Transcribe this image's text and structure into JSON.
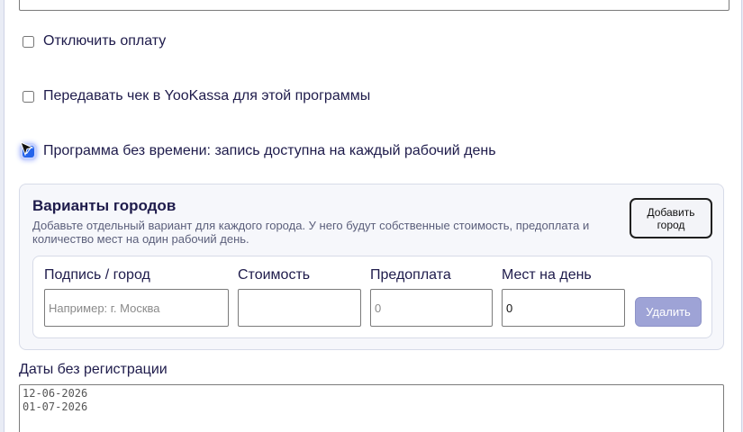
{
  "form": {
    "top_field_value": "",
    "options": [
      {
        "label": "Отключить оплату",
        "checked": false
      },
      {
        "label": "Передавать чек в YooKassa для этой программы",
        "checked": false
      },
      {
        "label": "Программа без времени: запись доступна на каждый рабочий день",
        "checked": true
      }
    ]
  },
  "cities": {
    "title": "Варианты городов",
    "description": "Добавьте отдельный вариант для каждого города. У него будут собственные стоимость, предоплата и количество мест на один рабочий день.",
    "add_button": "Добавить город",
    "columns": {
      "city": "Подпись / город",
      "price": "Стоимость",
      "prepay": "Предоплата",
      "seats": "Мест на день"
    },
    "row": {
      "city_placeholder": "Например: г. Москва",
      "city_value": "",
      "price_value": "",
      "prepay_placeholder": "0",
      "prepay_value": "",
      "seats_value": "0",
      "delete_button": "Удалить"
    }
  },
  "dates": {
    "label": "Даты без регистрации",
    "value": "12-06-2026\n01-07-2026"
  },
  "colors": {
    "accent": "#2563eb",
    "text": "#1e1b4b",
    "delete_button": "#9ea3d6"
  }
}
